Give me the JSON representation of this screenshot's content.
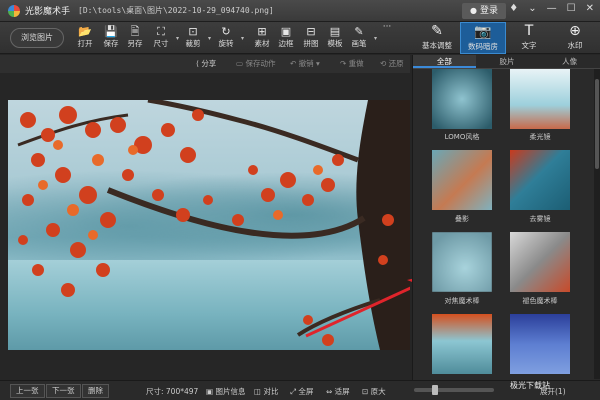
{
  "titlebar": {
    "app_name": "光影魔术手",
    "file_path": "[D:\\tools\\桌面\\图片\\2022-10-29_094740.png]",
    "login_label": "登录",
    "controls": [
      "♦",
      "⌄",
      "—",
      "☐",
      "✕"
    ]
  },
  "toolbar": {
    "browse_label": "浏览图片",
    "tools": [
      {
        "label": "打开",
        "icon": "📂"
      },
      {
        "label": "保存",
        "icon": "💾"
      },
      {
        "label": "另存",
        "icon": "🗎"
      },
      {
        "label": "尺寸",
        "icon": "⛶"
      },
      {
        "label": "裁剪",
        "icon": "⊡"
      },
      {
        "label": "旋转",
        "icon": "↻"
      },
      {
        "label": "素材",
        "icon": "⊞"
      },
      {
        "label": "边框",
        "icon": "▣"
      },
      {
        "label": "拼图",
        "icon": "⊟"
      },
      {
        "label": "模板",
        "icon": "▤"
      },
      {
        "label": "画笔",
        "icon": "✎"
      }
    ],
    "more_label": "···",
    "right_tabs": [
      {
        "label": "基本调整",
        "icon": "✎"
      },
      {
        "label": "数码暗房",
        "icon": "📷"
      },
      {
        "label": "文字",
        "icon": "T"
      },
      {
        "label": "水印",
        "icon": "⊕"
      }
    ],
    "active_right_tab": "数码暗房"
  },
  "subbar": {
    "share": "分享",
    "save_action": "保存动作",
    "undo": "撤销",
    "redo": "重做",
    "restore": "还原"
  },
  "panel": {
    "tabs": [
      "全部",
      "胶片",
      "人像"
    ],
    "active_tab": "全部",
    "effects": [
      "LOMO风格",
      "柔光镜",
      "叠影",
      "去雾镜",
      "对焦魔术棒",
      "褪色魔术棒",
      "",
      ""
    ]
  },
  "bottombar": {
    "prev": "上一张",
    "next": "下一张",
    "delete": "删除",
    "size_info": "尺寸: 700*497",
    "image_info": "图片信息",
    "compare": "对比",
    "fullscreen": "全屏",
    "fit": "适屏",
    "original": "原大",
    "zoom": "展开(1)",
    "watermark": "极光下载站"
  },
  "colors": {
    "accent": "#1d5d99",
    "arrow": "#e0242b"
  }
}
